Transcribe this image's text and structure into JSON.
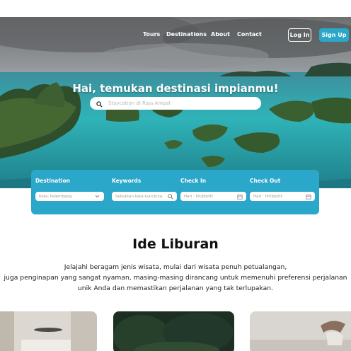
{
  "nav": {
    "links": [
      "Tours",
      "Destinations",
      "About",
      "Contact"
    ],
    "login_label": "Log In",
    "signup_label": "Sign Up"
  },
  "hero": {
    "title": "Hai, temukan destinasi impianmu!",
    "search_placeholder": "Staycation di Raja Ampat"
  },
  "booking": {
    "destination_label": "Destination",
    "destination_value": "Kota: Palembang",
    "keywords_label": "Keywords",
    "keywords_placeholder": "Sebutkan kata kuncinya",
    "checkin_label": "Check In",
    "checkin_placeholder": "Hari : hh/bb/ttt",
    "checkout_label": "Check Out",
    "checkout_placeholder": "Hari : hh/bb/ttt"
  },
  "section": {
    "title": "Ide Liburan",
    "line1": "Jelajahi beragam jenis wisata, mulai dari wisata penuh petualangan,",
    "line2": "juga penginapan yang sangat nyaman, masing-masing dirancang untuk memenuhi preferensi perjalanan",
    "line3": "unik Anda dan memastikan perjalanan yang tak terlupakan."
  },
  "colors": {
    "accent": "#2aa7c9",
    "sea": "#2fb3b8"
  }
}
